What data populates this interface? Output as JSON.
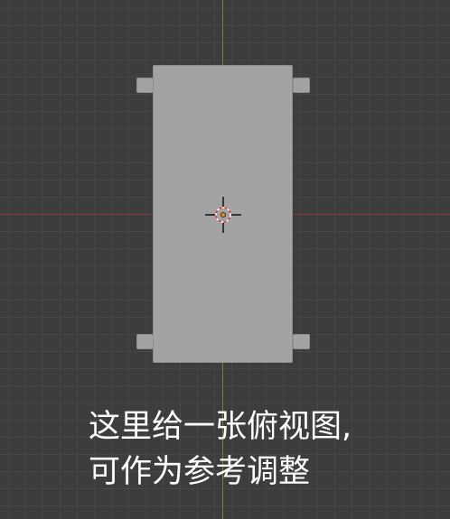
{
  "caption": {
    "line1": "这里给一张俯视图,",
    "line2": "可作为参考调整"
  },
  "colors": {
    "background": "#3d3d3d",
    "grid": "#474747",
    "axis_x": "#8a3a3a",
    "axis_y": "#6f8a2e",
    "object": "#a3a3a3",
    "origin": "#e58a1b"
  }
}
